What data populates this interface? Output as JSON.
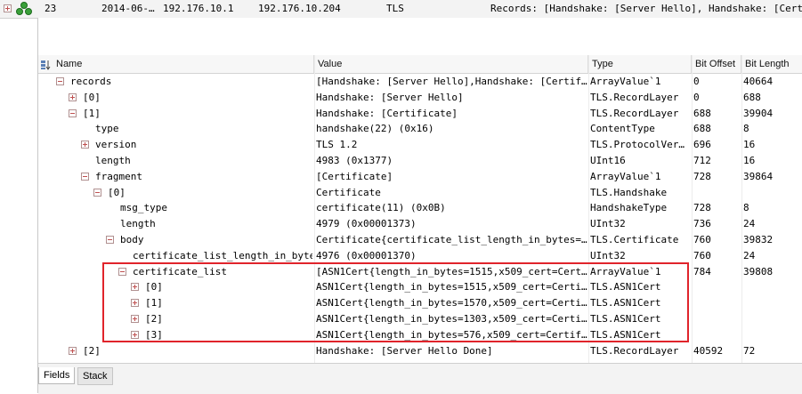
{
  "frame": {
    "number": "23",
    "time": "2014-06-…",
    "source": "192.176.10.1",
    "destination": "192.176.10.204",
    "protocol": "TLS",
    "summary": "Records: [Handshake: [Server Hello], Handshake: [Cert"
  },
  "columns": {
    "name": "Name",
    "value": "Value",
    "type": "Type",
    "bit_offset": "Bit Offset",
    "bit_length": "Bit Length"
  },
  "rows": [
    {
      "name": "records",
      "value": "[Handshake: [Server Hello],Handshake: [Certif…",
      "type": "ArrayValue`1",
      "bit_offset": "0",
      "bit_length": "40664",
      "expander": "minus"
    },
    {
      "name": "[0]",
      "value": "Handshake: [Server Hello]",
      "type": "TLS.RecordLayer",
      "bit_offset": "0",
      "bit_length": "688",
      "expander": "plus"
    },
    {
      "name": "[1]",
      "value": "Handshake: [Certificate]",
      "type": "TLS.RecordLayer",
      "bit_offset": "688",
      "bit_length": "39904",
      "expander": "minus"
    },
    {
      "name": "type",
      "value": "handshake(22) (0x16)",
      "type": "ContentType",
      "bit_offset": "688",
      "bit_length": "8",
      "expander": "none"
    },
    {
      "name": "version",
      "value": "TLS 1.2",
      "type": "TLS.ProtocolVer…",
      "bit_offset": "696",
      "bit_length": "16",
      "expander": "plus"
    },
    {
      "name": "length",
      "value": "4983 (0x1377)",
      "type": "UInt16",
      "bit_offset": "712",
      "bit_length": "16",
      "expander": "none"
    },
    {
      "name": "fragment",
      "value": "[Certificate]",
      "type": "ArrayValue`1",
      "bit_offset": "728",
      "bit_length": "39864",
      "expander": "minus"
    },
    {
      "name": "[0]",
      "value": "Certificate",
      "type": "TLS.Handshake",
      "bit_offset": "",
      "bit_length": "",
      "expander": "minus"
    },
    {
      "name": "msg_type",
      "value": "certificate(11) (0x0B)",
      "type": "HandshakeType",
      "bit_offset": "728",
      "bit_length": "8",
      "expander": "none"
    },
    {
      "name": "length",
      "value": "4979 (0x00001373)",
      "type": "UInt32",
      "bit_offset": "736",
      "bit_length": "24",
      "expander": "none"
    },
    {
      "name": "body",
      "value": "Certificate{certificate_list_length_in_bytes=…",
      "type": "TLS.Certificate",
      "bit_offset": "760",
      "bit_length": "39832",
      "expander": "minus"
    },
    {
      "name": "certificate_list_length_in_bytes",
      "value": "4976 (0x00001370)",
      "type": "UInt32",
      "bit_offset": "760",
      "bit_length": "24",
      "expander": "none"
    },
    {
      "name": "certificate_list",
      "value": "[ASN1Cert{length_in_bytes=1515,x509_cert=Cert…",
      "type": "ArrayValue`1",
      "bit_offset": "784",
      "bit_length": "39808",
      "expander": "minus"
    },
    {
      "name": "[0]",
      "value": "ASN1Cert{length_in_bytes=1515,x509_cert=Certi…",
      "type": "TLS.ASN1Cert",
      "bit_offset": "",
      "bit_length": "",
      "expander": "plus"
    },
    {
      "name": "[1]",
      "value": "ASN1Cert{length_in_bytes=1570,x509_cert=Certi…",
      "type": "TLS.ASN1Cert",
      "bit_offset": "",
      "bit_length": "",
      "expander": "plus"
    },
    {
      "name": "[2]",
      "value": "ASN1Cert{length_in_bytes=1303,x509_cert=Certi…",
      "type": "TLS.ASN1Cert",
      "bit_offset": "",
      "bit_length": "",
      "expander": "plus"
    },
    {
      "name": "[3]",
      "value": "ASN1Cert{length_in_bytes=576,x509_cert=Certif…",
      "type": "TLS.ASN1Cert",
      "bit_offset": "",
      "bit_length": "",
      "expander": "plus"
    },
    {
      "name": "[2]",
      "value": "Handshake: [Server Hello Done]",
      "type": "TLS.RecordLayer",
      "bit_offset": "40592",
      "bit_length": "72",
      "expander": "plus"
    }
  ],
  "tabs": [
    "Fields",
    "Stack"
  ],
  "icons": {
    "frame": "network-nodes-icon",
    "sort": "sort-icon"
  },
  "colors": {
    "highlight": "#e0242b",
    "expander": "#c05050"
  }
}
